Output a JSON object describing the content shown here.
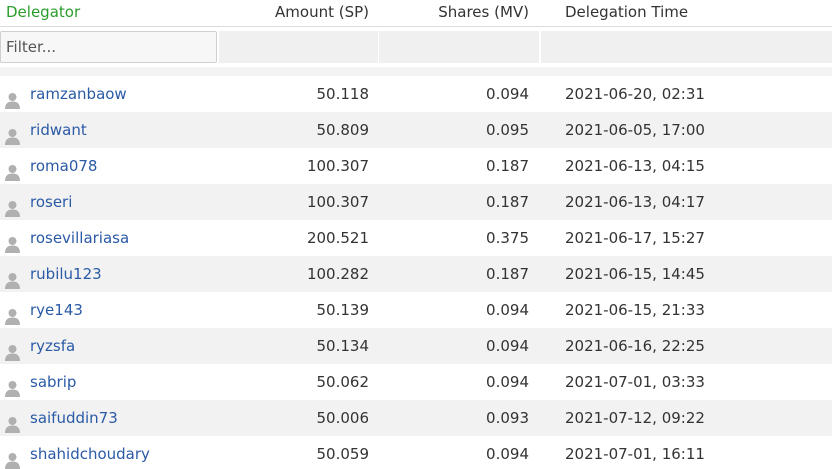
{
  "header": {
    "delegator": "Delegator",
    "amount": "Amount (SP)",
    "shares": "Shares (MV)",
    "time": "Delegation Time"
  },
  "filter": {
    "placeholder": "Filter..."
  },
  "colors": {
    "sorted_header": "#2a9d2a",
    "link": "#2a5aa6",
    "row_alt": "#f2f2f2",
    "user_icon": "#b0b0b0"
  },
  "rows": [
    {
      "icon": "user-icon",
      "name": "ramzanbaow",
      "amount": "50.118",
      "shares": "0.094",
      "time": "2021-06-20, 02:31"
    },
    {
      "icon": "user-icon",
      "name": "ridwant",
      "amount": "50.809",
      "shares": "0.095",
      "time": "2021-06-05, 17:00"
    },
    {
      "icon": "user-icon",
      "name": "roma078",
      "amount": "100.307",
      "shares": "0.187",
      "time": "2021-06-13, 04:15"
    },
    {
      "icon": "user-icon",
      "name": "roseri",
      "amount": "100.307",
      "shares": "0.187",
      "time": "2021-06-13, 04:17"
    },
    {
      "icon": "user-icon",
      "name": "rosevillariasa",
      "amount": "200.521",
      "shares": "0.375",
      "time": "2021-06-17, 15:27"
    },
    {
      "icon": "user-icon",
      "name": "rubilu123",
      "amount": "100.282",
      "shares": "0.187",
      "time": "2021-06-15, 14:45"
    },
    {
      "icon": "user-icon",
      "name": "rye143",
      "amount": "50.139",
      "shares": "0.094",
      "time": "2021-06-15, 21:33"
    },
    {
      "icon": "user-icon",
      "name": "ryzsfa",
      "amount": "50.134",
      "shares": "0.094",
      "time": "2021-06-16, 22:25"
    },
    {
      "icon": "user-icon",
      "name": "sabrip",
      "amount": "50.062",
      "shares": "0.094",
      "time": "2021-07-01, 03:33"
    },
    {
      "icon": "user-icon",
      "name": "saifuddin73",
      "amount": "50.006",
      "shares": "0.093",
      "time": "2021-07-12, 09:22"
    },
    {
      "icon": "user-icon",
      "name": "shahidchoudary",
      "amount": "50.059",
      "shares": "0.094",
      "time": "2021-07-01, 16:11"
    }
  ]
}
